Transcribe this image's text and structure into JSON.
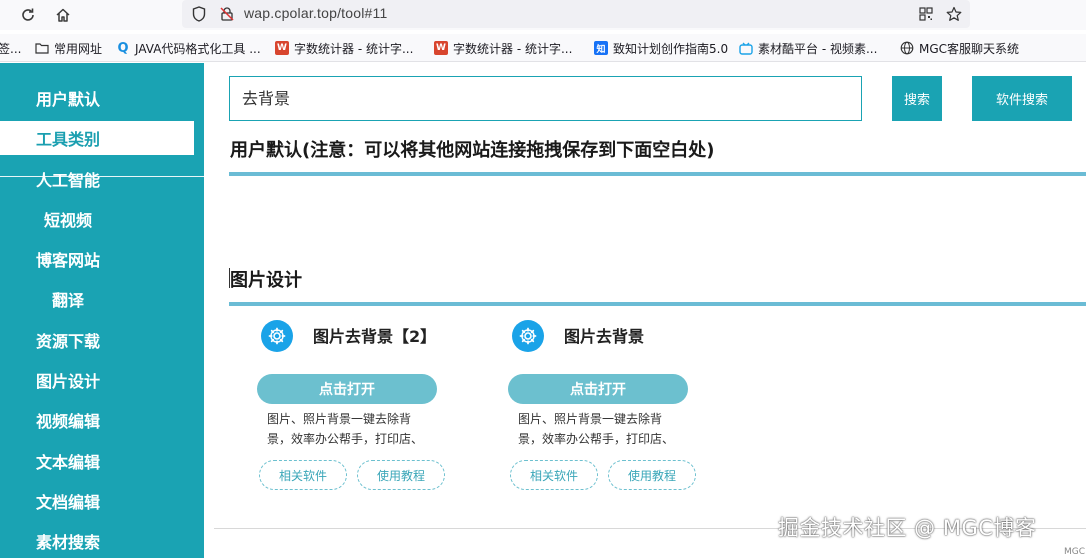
{
  "browser": {
    "url": "wap.cpolar.top/tool#11",
    "icons": [
      "reload-icon",
      "home-icon",
      "shield-icon",
      "tracking-icon",
      "qr-code-icon",
      "star-icon"
    ],
    "bookmarks": [
      {
        "label": "签...",
        "icon": ""
      },
      {
        "label": "常用网址",
        "icon": "folder-icon"
      },
      {
        "label": "JAVA代码格式化工具 ...",
        "icon": "Q"
      },
      {
        "label": "字数统计器 - 统计字...",
        "icon": "W"
      },
      {
        "label": "字数统计器 - 统计字...",
        "icon": "W"
      },
      {
        "label": "致知计划创作指南5.0",
        "icon": "知"
      },
      {
        "label": "素材酷平台 - 视频素...",
        "icon": "tv-icon"
      },
      {
        "label": "MGC客服聊天系统",
        "icon": "globe-icon"
      }
    ]
  },
  "sidebar": {
    "items": [
      {
        "label": "用户默认"
      },
      {
        "label": "工具类别"
      },
      {
        "label": "人工智能"
      },
      {
        "label": "短视频"
      },
      {
        "label": "博客网站"
      },
      {
        "label": "翻译"
      },
      {
        "label": "资源下载"
      },
      {
        "label": "图片设计"
      },
      {
        "label": "视频编辑"
      },
      {
        "label": "文本编辑"
      },
      {
        "label": "文档编辑"
      },
      {
        "label": "素材搜索"
      }
    ],
    "active_index": 1
  },
  "search": {
    "value": "去背景",
    "search_button": "搜索",
    "software_search_button": "软件搜索"
  },
  "sections": {
    "user_default_title": "用户默认(注意：可以将其他网站连接拖拽保存到下面空白处)",
    "image_design_title": "图片设计"
  },
  "cards": [
    {
      "title": "图片去背景【2】",
      "open_label": "点击打开",
      "desc_line1": "图片、照片背景一键去除背",
      "desc_line2": "景，效率办公帮手，打印店、",
      "related_label": "相关软件",
      "tutorial_label": "使用教程"
    },
    {
      "title": "图片去背景",
      "open_label": "点击打开",
      "desc_line1": "图片、照片背景一键去除背",
      "desc_line2": "景，效率办公帮手，打印店、",
      "related_label": "相关软件",
      "tutorial_label": "使用教程"
    }
  ],
  "footer": {
    "watermark": "掘金技术社区 @ MGC博客",
    "corner_text": "MGC"
  },
  "colors": {
    "accent": "#1aa3b3",
    "divider": "#6bbcd5",
    "button_light": "#6cc0cf",
    "icon_blue": "#1aa3e8"
  }
}
